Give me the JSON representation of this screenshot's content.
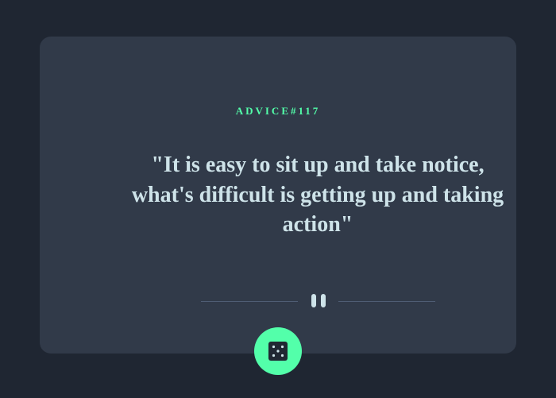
{
  "advice": {
    "label": "ADVICE",
    "number_prefix": "#",
    "id": "117",
    "quote": "\"It is easy to sit up and take notice, what's difficult is getting up and taking action\""
  },
  "divider": {
    "icon": "pause-icon"
  },
  "dice_button": {
    "icon": "dice-icon"
  },
  "colors": {
    "background": "#1f2632",
    "card": "#313a49",
    "accent": "#53ffaa",
    "text": "#cee3e9",
    "divider_line": "#4f5d74"
  }
}
